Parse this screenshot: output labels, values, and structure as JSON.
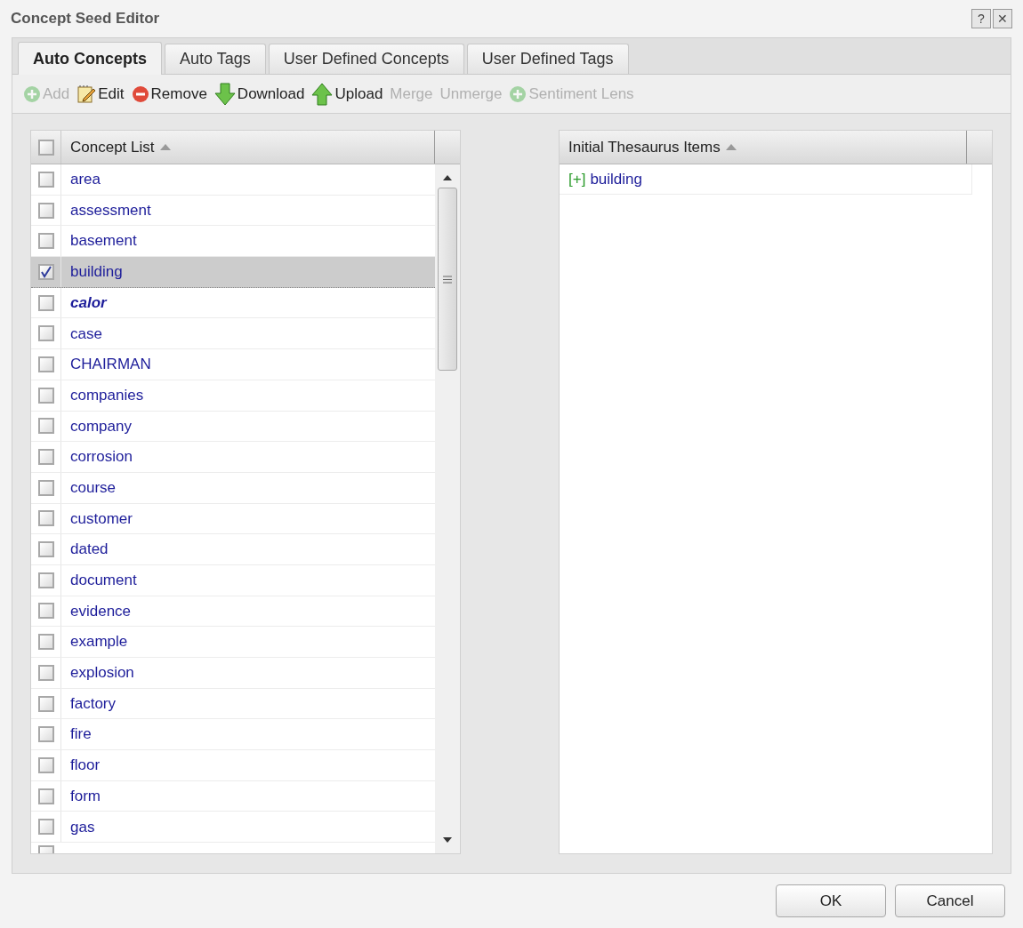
{
  "window": {
    "title": "Concept Seed Editor",
    "controls": [
      "?",
      "✕"
    ]
  },
  "tabs": [
    {
      "label": "Auto Concepts",
      "selected": true
    },
    {
      "label": "Auto Tags",
      "selected": false
    },
    {
      "label": "User Defined Concepts",
      "selected": false
    },
    {
      "label": "User Defined Tags",
      "selected": false
    }
  ],
  "toolbar": [
    {
      "kind": "add",
      "label": "Add",
      "disabled": true
    },
    {
      "kind": "edit",
      "label": "Edit",
      "disabled": false
    },
    {
      "kind": "remove",
      "label": "Remove",
      "disabled": false
    },
    {
      "kind": "download",
      "label": "Download",
      "disabled": false
    },
    {
      "kind": "upload",
      "label": "Upload",
      "disabled": false
    },
    {
      "kind": "plain",
      "label": "Merge",
      "disabled": true
    },
    {
      "kind": "plain",
      "label": "Unmerge",
      "disabled": true
    },
    {
      "kind": "add",
      "label": "Sentiment Lens",
      "disabled": true
    }
  ],
  "concept_list": {
    "header": "Concept List",
    "header_checked": false,
    "rows": [
      {
        "label": "area",
        "checked": false,
        "selected": false,
        "emphasized": false
      },
      {
        "label": "assessment",
        "checked": false,
        "selected": false,
        "emphasized": false
      },
      {
        "label": "basement",
        "checked": false,
        "selected": false,
        "emphasized": false
      },
      {
        "label": "building",
        "checked": true,
        "selected": true,
        "emphasized": false
      },
      {
        "label": "calor",
        "checked": false,
        "selected": false,
        "emphasized": true
      },
      {
        "label": "case",
        "checked": false,
        "selected": false,
        "emphasized": false
      },
      {
        "label": "CHAIRMAN",
        "checked": false,
        "selected": false,
        "emphasized": false
      },
      {
        "label": "companies",
        "checked": false,
        "selected": false,
        "emphasized": false
      },
      {
        "label": "company",
        "checked": false,
        "selected": false,
        "emphasized": false
      },
      {
        "label": "corrosion",
        "checked": false,
        "selected": false,
        "emphasized": false
      },
      {
        "label": "course",
        "checked": false,
        "selected": false,
        "emphasized": false
      },
      {
        "label": "customer",
        "checked": false,
        "selected": false,
        "emphasized": false
      },
      {
        "label": "dated",
        "checked": false,
        "selected": false,
        "emphasized": false
      },
      {
        "label": "document",
        "checked": false,
        "selected": false,
        "emphasized": false
      },
      {
        "label": "evidence",
        "checked": false,
        "selected": false,
        "emphasized": false
      },
      {
        "label": "example",
        "checked": false,
        "selected": false,
        "emphasized": false
      },
      {
        "label": "explosion",
        "checked": false,
        "selected": false,
        "emphasized": false
      },
      {
        "label": "factory",
        "checked": false,
        "selected": false,
        "emphasized": false
      },
      {
        "label": "fire",
        "checked": false,
        "selected": false,
        "emphasized": false
      },
      {
        "label": "floor",
        "checked": false,
        "selected": false,
        "emphasized": false
      },
      {
        "label": "form",
        "checked": false,
        "selected": false,
        "emphasized": false
      },
      {
        "label": "gas",
        "checked": false,
        "selected": false,
        "emphasized": false
      }
    ],
    "partial_row": {
      "checked": false
    }
  },
  "thesaurus": {
    "header": "Initial Thesaurus Items",
    "items": [
      {
        "marker": "[+]",
        "label": "building"
      }
    ]
  },
  "buttons": [
    "OK",
    "Cancel"
  ]
}
